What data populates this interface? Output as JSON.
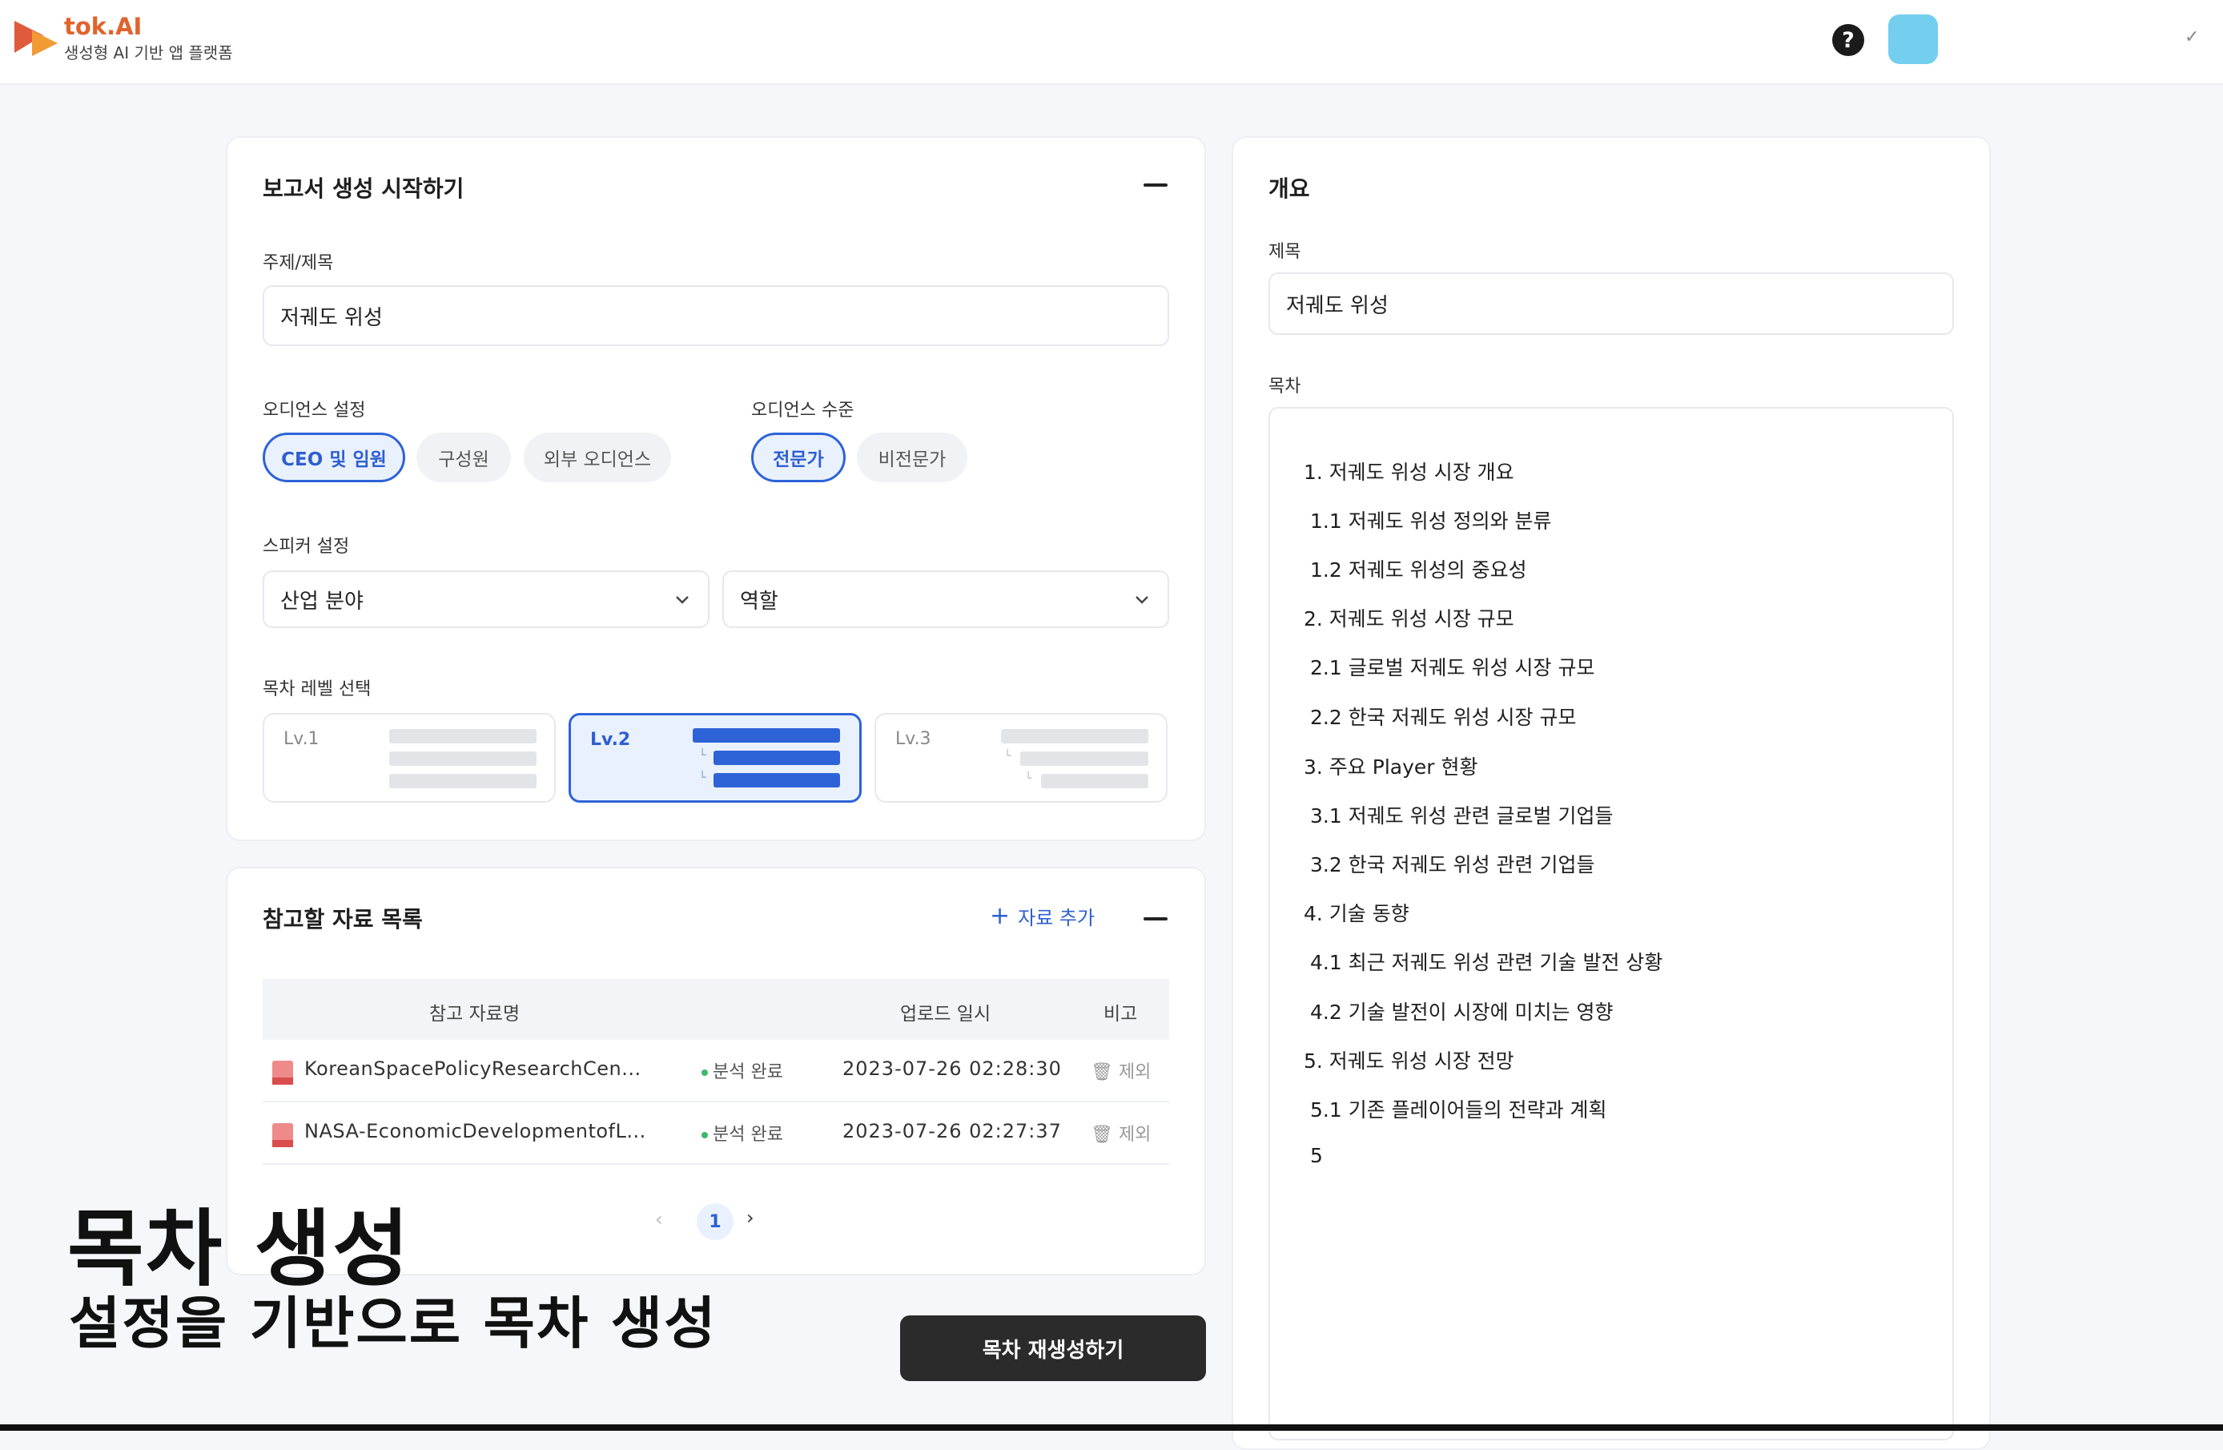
{
  "header": {
    "brand": "tok.AI",
    "tagline": "생성형 AI 기반 앱 플랫폼",
    "brand_color": "#e0632c",
    "help_icon": "?",
    "menu_check": "✓"
  },
  "report": {
    "title": "보고서 생성 시작하기",
    "topic_label": "주제/제목",
    "topic_value": "저궤도 위성",
    "audience_label": "오디언스 설정",
    "audience_options": [
      "CEO 및 임원",
      "구성원",
      "외부 오디언스"
    ],
    "audience_selected": "CEO 및 임원",
    "level_label": "오디언스 수준",
    "level_options": [
      "전문가",
      "비전문가"
    ],
    "level_selected": "전문가",
    "speaker_label": "스피커 설정",
    "speaker_industry": "산업 분야",
    "speaker_role": "역할",
    "toc_level_label": "목차 레벨 선택",
    "toc_levels": [
      "Lv.1",
      "Lv.2",
      "Lv.3"
    ],
    "toc_level_selected": "Lv.2"
  },
  "references": {
    "title": "참고할 자료 목록",
    "add_label": "자료 추가",
    "columns": [
      "참고 자료명",
      "업로드 일시",
      "비고"
    ],
    "rows": [
      {
        "name": "KoreanSpacePolicyResearchCen...",
        "status": "분석 완료",
        "date": "2023-07-26 02:28:30",
        "action": "제외"
      },
      {
        "name": "NASA-EconomicDevelopmentofL...",
        "status": "분석 완료",
        "date": "2023-07-26 02:27:37",
        "action": "제외"
      }
    ],
    "page": "1"
  },
  "generate_button": "목차 재생성하기",
  "caption": {
    "main": "목차 생성",
    "sub": "설정을 기반으로 목차 생성"
  },
  "overview": {
    "title": "개요",
    "title_label": "제목",
    "title_value": "저궤도 위성",
    "toc_label": "목차",
    "toc": [
      "1. 저궤도 위성 시장 개요",
      "1.1 저궤도 위성 정의와 분류",
      "1.2 저궤도 위성의 중요성",
      "2. 저궤도 위성 시장 규모",
      "2.1 글로벌 저궤도 위성 시장 규모",
      "2.2 한국 저궤도 위성 시장 규모",
      "3. 주요 Player 현황",
      "3.1 저궤도 위성 관련 글로벌 기업들",
      "3.2 한국 저궤도 위성 관련 기업들",
      "4. 기술 동향",
      "4.1 최근 저궤도 위성 관련 기술 발전 상황",
      "4.2 기술 발전이 시장에 미치는 영향",
      "5. 저궤도 위성 시장 전망",
      "5.1 기존 플레이어들의 전략과 계획",
      "5"
    ]
  },
  "colors": {
    "accent": "#2e63d8",
    "accent_bg": "#eaf1fe",
    "avatar": "#74cfee",
    "button_dark": "#2b2b2b"
  }
}
